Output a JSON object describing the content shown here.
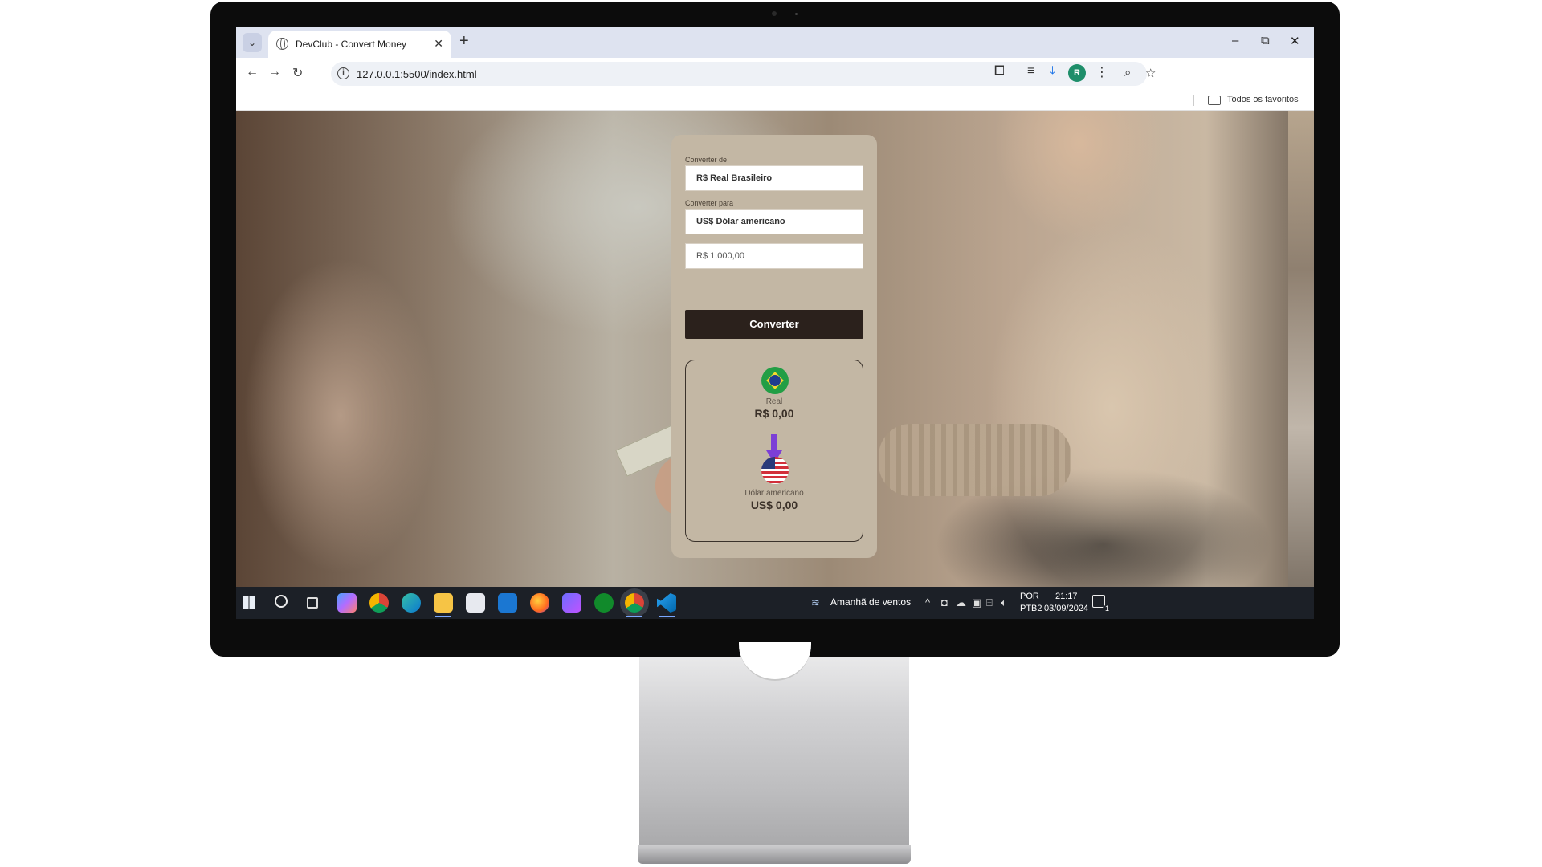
{
  "browser": {
    "tab_title": "DevClub - Convert Money",
    "tab_close": "✕",
    "new_tab": "+",
    "url": "127.0.0.1:5500/index.html",
    "bookmarks_label": "Todos os favoritos",
    "profile_initial": "R",
    "window_controls": {
      "minimize": "–",
      "restore": "⧉",
      "close": "✕"
    },
    "nav": {
      "back": "←",
      "forward": "→",
      "reload": "↻"
    }
  },
  "converter": {
    "from_label": "Converter de",
    "from_value": "R$ Real Brasileiro",
    "to_label": "Converter para",
    "to_value": "US$ Dólar americano",
    "amount_value": "R$ 1.000,00",
    "button_label": "Converter",
    "result": {
      "from_currency_name": "Real",
      "from_currency_value": "R$ 0,00",
      "to_currency_name": "Dólar americano",
      "to_currency_value": "US$ 0,00"
    }
  },
  "taskbar": {
    "weather_text": "Amanhã de ventos",
    "language_line1": "POR",
    "language_line2": "PTB2",
    "time": "21:17",
    "date": "03/09/2024",
    "notification_count": "1",
    "icons": [
      "windows-start-icon",
      "search-icon",
      "task-view-icon",
      "copilot-icon",
      "chrome-icon",
      "edge-icon",
      "file-explorer-icon",
      "store-icon",
      "mail-icon",
      "firefox-icon",
      "media-player-icon",
      "xbox-icon",
      "chrome-active-icon",
      "vscode-icon"
    ]
  },
  "colors": {
    "card_bg": "#c3b7a4",
    "button_bg": "#2b211c",
    "arrow": "#7c3fd6",
    "taskbar_bg": "#1c2027"
  }
}
